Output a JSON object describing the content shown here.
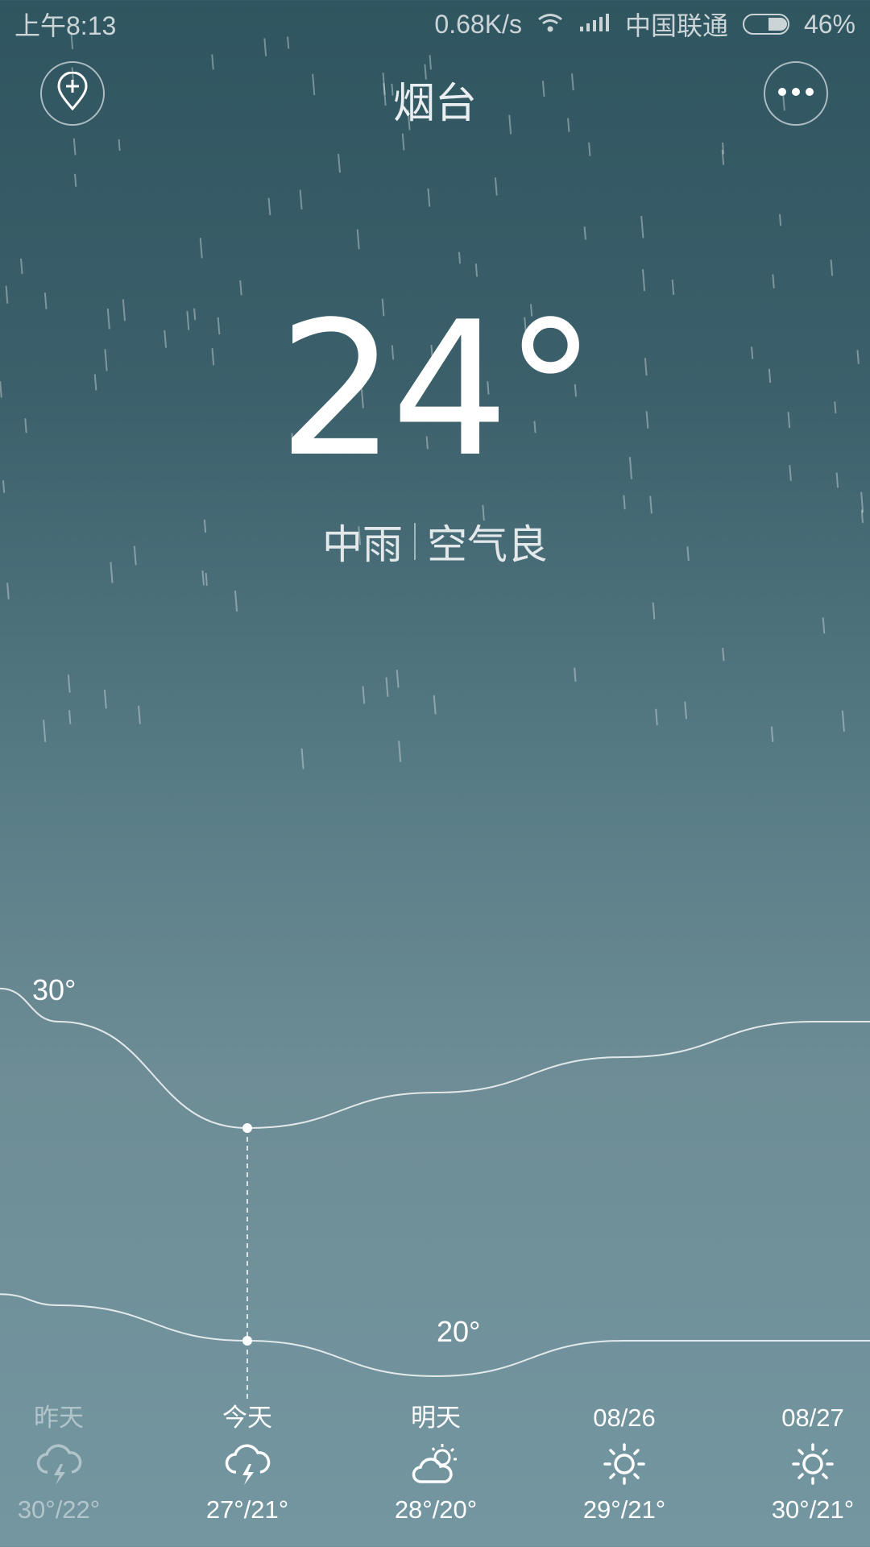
{
  "status_bar": {
    "time": "上午8:13",
    "network_speed": "0.68K/s",
    "carrier": "中国联通",
    "battery": "46%",
    "battery_level": 0.46
  },
  "header": {
    "city": "烟台",
    "add_location_icon": "location-plus-icon",
    "more_icon": "more-dots-icon"
  },
  "current": {
    "temperature": "24°",
    "condition": "中雨",
    "air_quality": "空气良"
  },
  "chart": {
    "high_label": "30°",
    "low_label": "20°"
  },
  "chart_data": {
    "type": "line",
    "categories": [
      "昨天",
      "今天",
      "明天",
      "08/26",
      "08/27"
    ],
    "series": [
      {
        "values": [
          30,
          27,
          28,
          29,
          30
        ]
      },
      {
        "values": [
          22,
          21,
          20,
          21,
          21
        ]
      }
    ],
    "selected_category": "今天"
  },
  "forecast": [
    {
      "label": "昨天",
      "icon": "thunder-rain-icon",
      "range": "30°/22°",
      "past": true
    },
    {
      "label": "今天",
      "icon": "thunder-rain-icon",
      "range": "27°/21°",
      "past": false
    },
    {
      "label": "明天",
      "icon": "partly-cloudy-icon",
      "range": "28°/20°",
      "past": false
    },
    {
      "label": "08/26",
      "icon": "sun-icon",
      "range": "29°/21°",
      "past": false
    },
    {
      "label": "08/27",
      "icon": "sun-icon",
      "range": "30°/21°",
      "past": false
    }
  ]
}
